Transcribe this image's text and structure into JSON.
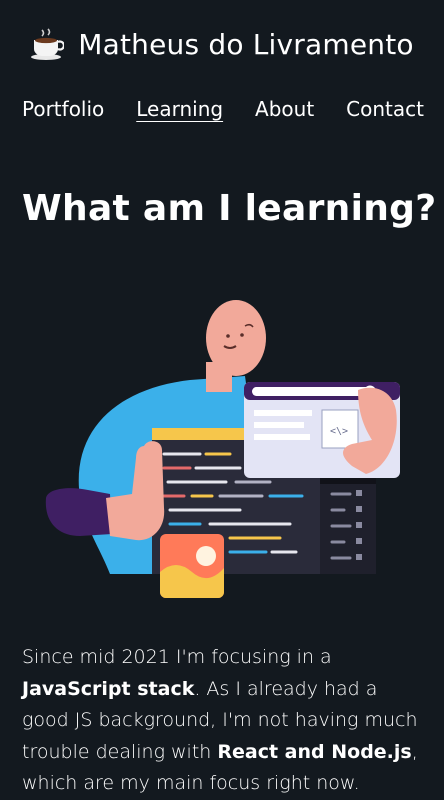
{
  "header": {
    "site_title": "Matheus do Livramento",
    "logo_icon": "coffee-cup-icon"
  },
  "nav": {
    "items": [
      {
        "label": "Portfolio"
      },
      {
        "label": "Learning",
        "active": true
      },
      {
        "label": "About"
      },
      {
        "label": "Contact"
      }
    ]
  },
  "main": {
    "title": "What am I learning?",
    "illustration": "developer-coding-illustration",
    "paragraph": {
      "t1": "Since mid 2021 I'm focusing in a ",
      "b1": "JavaScript stack",
      "t2": ". As I already had a good JS background, I'm not having much trouble dealing with ",
      "b2": "React and Node.js",
      "t3": ", which are my main focus right now."
    }
  },
  "colors": {
    "background": "#13191f",
    "text": "#ffffff",
    "shirt": "#3bb0ea",
    "skin": "#f2a99a",
    "editor": "#2a2b3a",
    "accent": "#f6c64b"
  }
}
